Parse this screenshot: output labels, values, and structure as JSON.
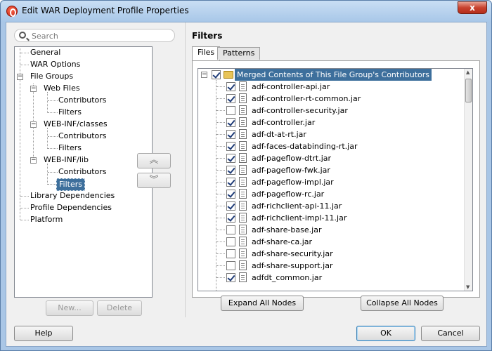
{
  "window": {
    "title": "Edit WAR Deployment Profile Properties",
    "close_label": "x"
  },
  "search": {
    "placeholder": "Search"
  },
  "nav_tree": [
    {
      "label": "General"
    },
    {
      "label": "WAR Options"
    },
    {
      "label": "File Groups"
    },
    {
      "label": "Web Files"
    },
    {
      "label": "Contributors"
    },
    {
      "label": "Filters"
    },
    {
      "label": "WEB-INF/classes"
    },
    {
      "label": "Contributors"
    },
    {
      "label": "Filters"
    },
    {
      "label": "WEB-INF/lib"
    },
    {
      "label": "Contributors"
    },
    {
      "label": "Filters"
    },
    {
      "label": "Library Dependencies"
    },
    {
      "label": "Profile Dependencies"
    },
    {
      "label": "Platform"
    }
  ],
  "left_buttons": {
    "new": "New...",
    "delete": "Delete"
  },
  "panel": {
    "title": "Filters"
  },
  "tabs": [
    {
      "label": "Files"
    },
    {
      "label": "Patterns"
    }
  ],
  "root_node": {
    "label": "Merged Contents of This File Group's Contributors",
    "checked": true
  },
  "files": [
    {
      "name": "adf-controller-api.jar",
      "checked": true
    },
    {
      "name": "adf-controller-rt-common.jar",
      "checked": true
    },
    {
      "name": "adf-controller-security.jar",
      "checked": false
    },
    {
      "name": "adf-controller.jar",
      "checked": true
    },
    {
      "name": "adf-dt-at-rt.jar",
      "checked": true
    },
    {
      "name": "adf-faces-databinding-rt.jar",
      "checked": true
    },
    {
      "name": "adf-pageflow-dtrt.jar",
      "checked": true
    },
    {
      "name": "adf-pageflow-fwk.jar",
      "checked": true
    },
    {
      "name": "adf-pageflow-impl.jar",
      "checked": true
    },
    {
      "name": "adf-pageflow-rc.jar",
      "checked": true
    },
    {
      "name": "adf-richclient-api-11.jar",
      "checked": true
    },
    {
      "name": "adf-richclient-impl-11.jar",
      "checked": true
    },
    {
      "name": "adf-share-base.jar",
      "checked": false
    },
    {
      "name": "adf-share-ca.jar",
      "checked": false
    },
    {
      "name": "adf-share-security.jar",
      "checked": false
    },
    {
      "name": "adf-share-support.jar",
      "checked": false
    },
    {
      "name": "adfdt_common.jar",
      "checked": true
    }
  ],
  "file_buttons": {
    "expand": "Expand All Nodes",
    "collapse": "Collapse All Nodes"
  },
  "footer": {
    "help": "Help",
    "ok": "OK",
    "cancel": "Cancel"
  }
}
